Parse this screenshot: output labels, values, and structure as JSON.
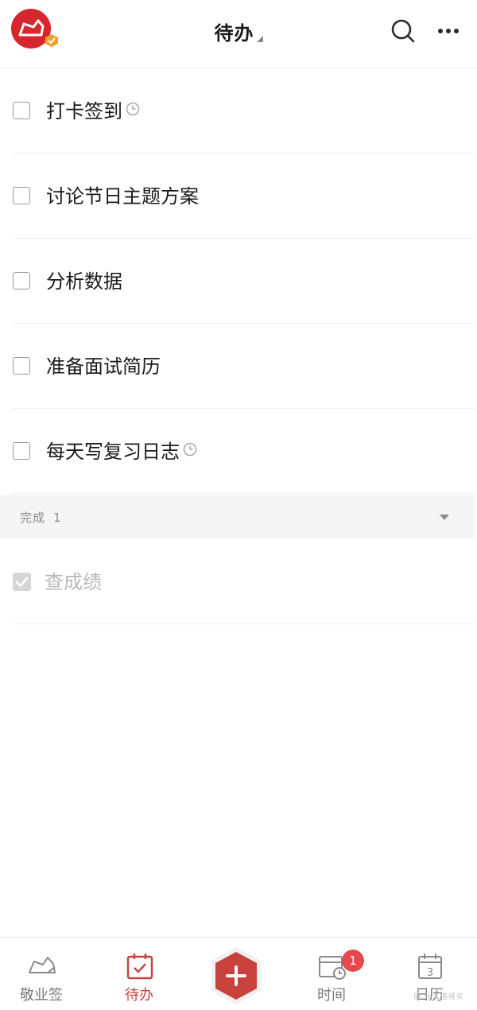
{
  "header": {
    "title": "待办",
    "avatar_icon": "cloud-app-logo-icon",
    "search_icon": "search-icon",
    "more_icon": "more-dots-icon"
  },
  "todos": [
    {
      "label": "打卡签到",
      "reminder": true
    },
    {
      "label": "讨论节日主题方案",
      "reminder": false
    },
    {
      "label": "分析数据",
      "reminder": false
    },
    {
      "label": "准备面试简历",
      "reminder": false
    },
    {
      "label": "每天写复习日志",
      "reminder": true
    }
  ],
  "completed": {
    "label": "完成",
    "count": "1",
    "items": [
      {
        "label": "查成绩",
        "checked": true
      }
    ]
  },
  "tabbar": {
    "tabs": [
      {
        "label": "敬业签",
        "icon": "memo-icon"
      },
      {
        "label": "待办",
        "icon": "calendar-check-icon",
        "active": true
      },
      {
        "label": "",
        "icon": "add-icon"
      },
      {
        "label": "时间",
        "icon": "calendar-clock-icon",
        "badge": "1"
      },
      {
        "label": "日历",
        "icon": "calendar-icon"
      }
    ],
    "calendar_day": "3"
  },
  "watermark": "值 什么值得买",
  "colors": {
    "accent": "#c9413d",
    "badge": "#e5484d",
    "divider": "#eeeeee"
  }
}
